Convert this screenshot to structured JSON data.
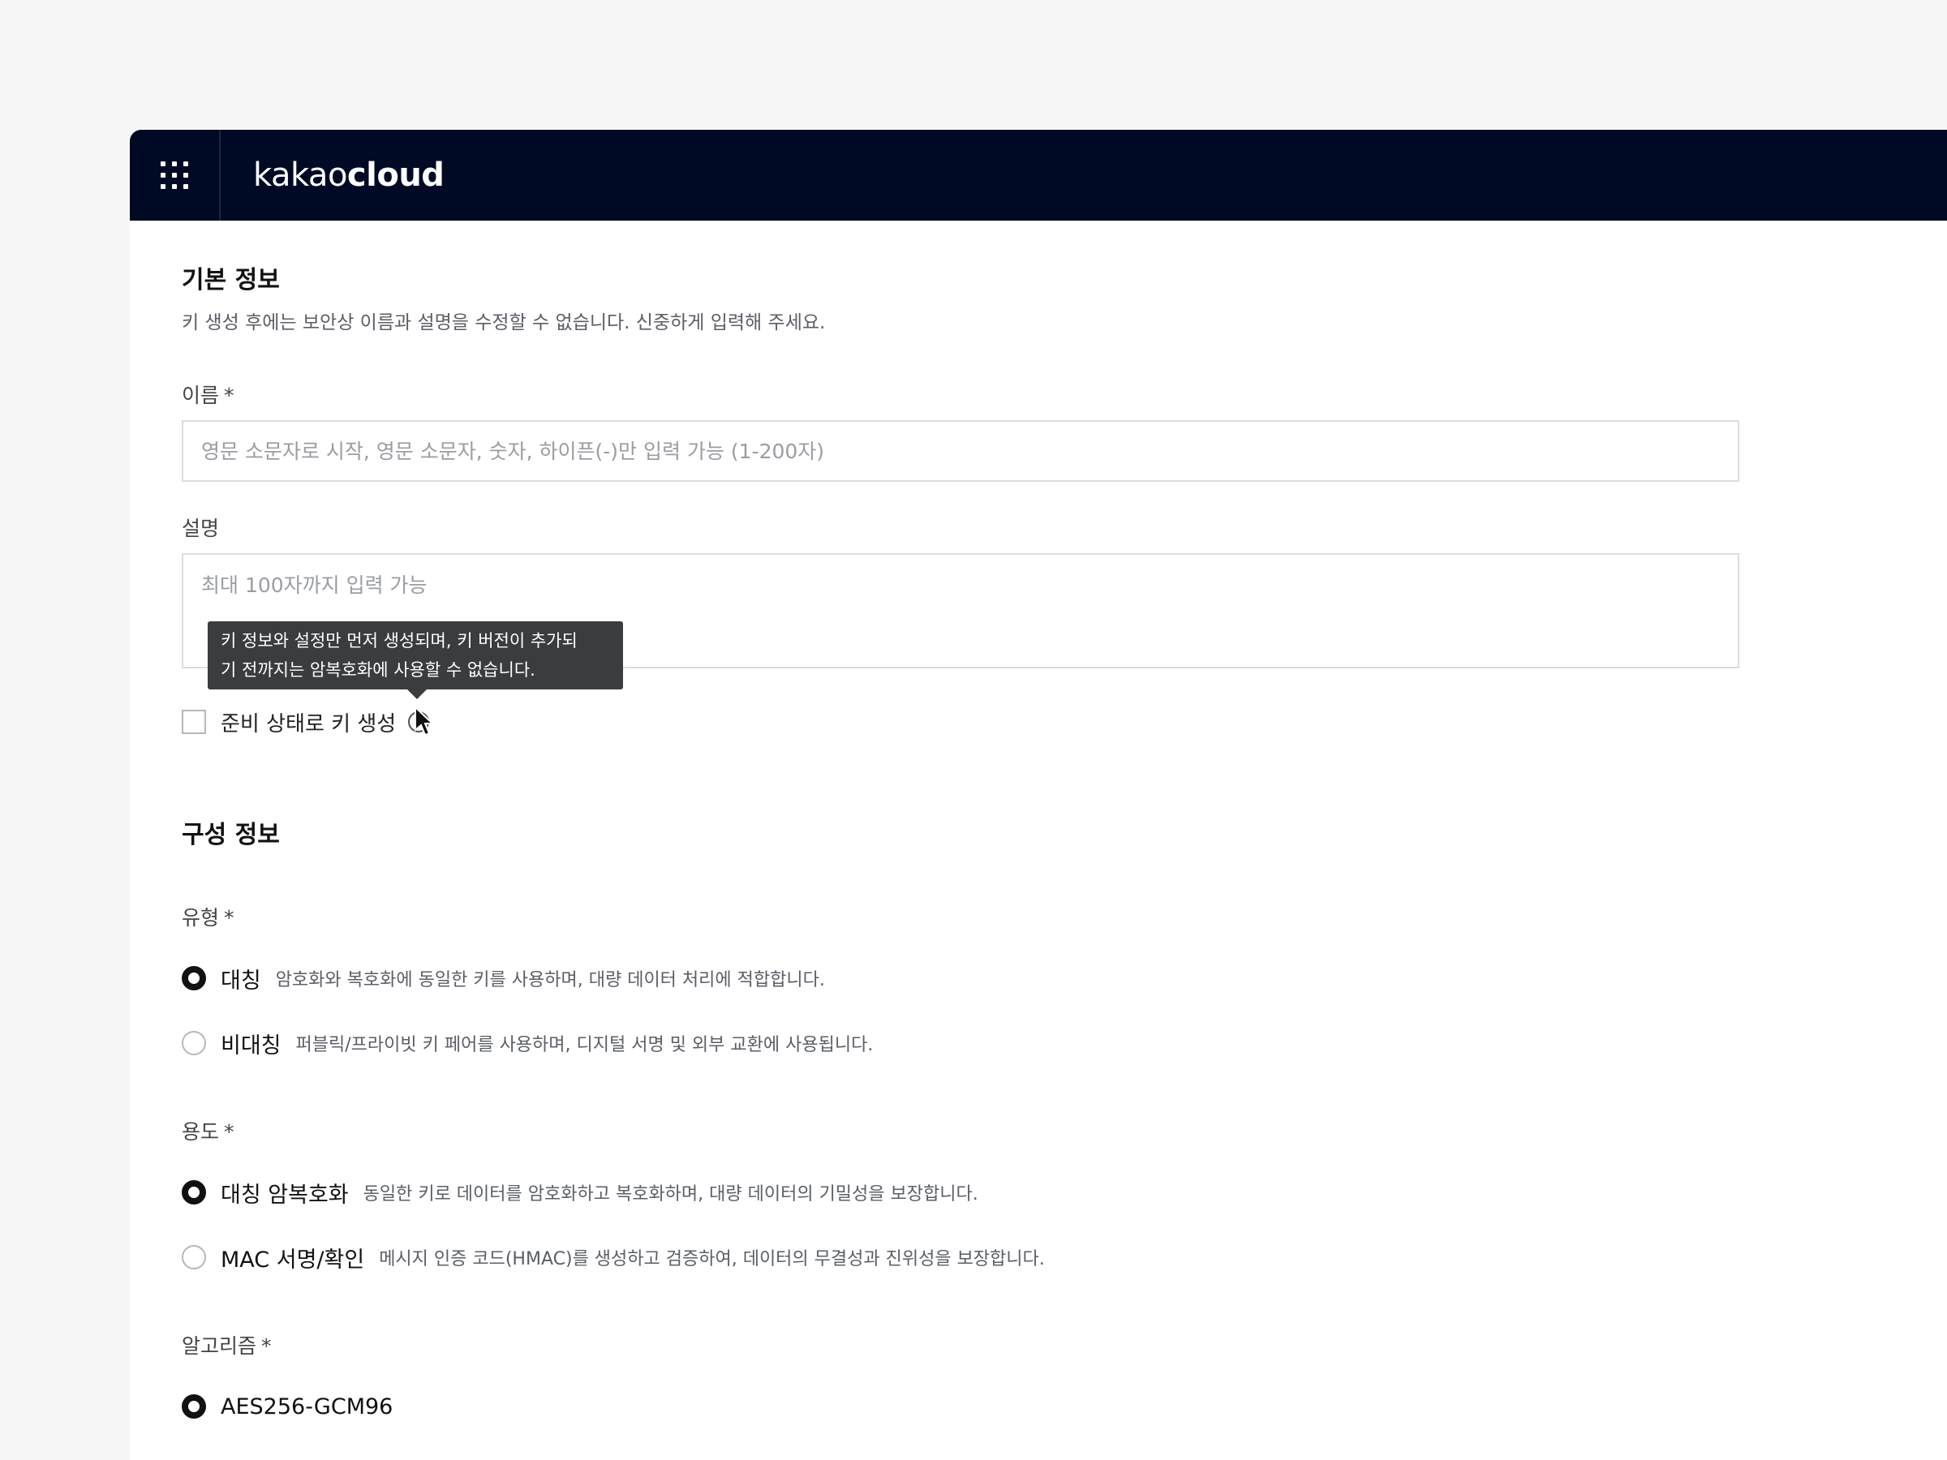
{
  "header": {
    "logo_light": "kakao",
    "logo_bold": "cloud",
    "menu_icon": "grid-icon"
  },
  "basic": {
    "title": "기본 정보",
    "desc": "키 생성 후에는 보안상 이름과 설명을 수정할 수 없습니다. 신중하게 입력해 주세요.",
    "name_label": "이름",
    "required_mark": "*",
    "name_placeholder": "영문 소문자로 시작, 영문 소문자, 숫자, 하이픈(-)만 입력 가능 (1-200자)",
    "desc_label": "설명",
    "desc_placeholder": "최대 100자까지 입력 가능",
    "checkbox_label": "준비 상태로 키 생성",
    "tooltip_line1": "키 정보와 설정만 먼저 생성되며, 키 버전이 추가되",
    "tooltip_line2": "기 전까지는 암복호화에 사용할 수 없습니다."
  },
  "config": {
    "title": "구성 정보",
    "type_label": "유형",
    "type_options": [
      {
        "label": "대칭",
        "desc": "암호화와 복호화에 동일한 키를 사용하며, 대량 데이터 처리에 적합합니다.",
        "selected": true
      },
      {
        "label": "비대칭",
        "desc": "퍼블릭/프라이빗 키 페어를 사용하며, 디지털 서명 및 외부 교환에 사용됩니다.",
        "selected": false
      }
    ],
    "usage_label": "용도",
    "usage_options": [
      {
        "label": "대칭 암복호화",
        "desc": "동일한 키로 데이터를 암호화하고 복호화하며, 대량 데이터의 기밀성을 보장합니다.",
        "selected": true
      },
      {
        "label": "MAC 서명/확인",
        "desc": "메시지 인증 코드(HMAC)를 생성하고 검증하여, 데이터의 무결성과 진위성을 보장합니다.",
        "selected": false
      }
    ],
    "algo_label": "알고리즘",
    "algo_options": [
      {
        "label": "AES256-GCM96",
        "selected": true
      }
    ]
  }
}
